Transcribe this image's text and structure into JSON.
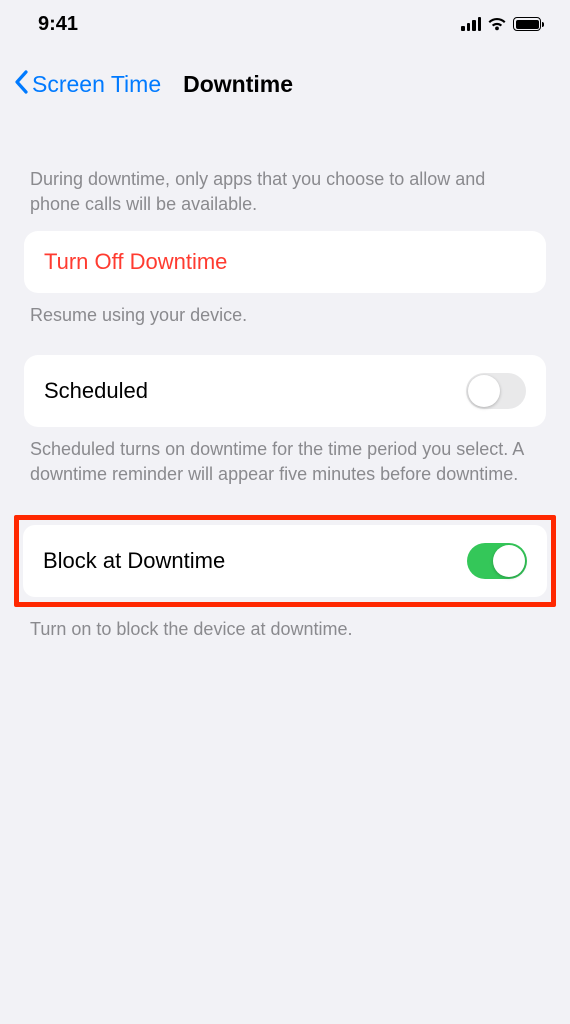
{
  "status": {
    "time": "9:41"
  },
  "nav": {
    "back_label": "Screen Time",
    "title": "Downtime"
  },
  "sections": {
    "intro": "During downtime, only apps that you choose to allow and phone calls will be available.",
    "turn_off": {
      "label": "Turn Off Downtime",
      "footer": "Resume using your device."
    },
    "scheduled": {
      "label": "Scheduled",
      "enabled": false,
      "footer": "Scheduled turns on downtime for the time period you select. A downtime reminder will appear five minutes before downtime."
    },
    "block": {
      "label": "Block at Downtime",
      "enabled": true,
      "footer": "Turn on to block the device at downtime."
    }
  }
}
